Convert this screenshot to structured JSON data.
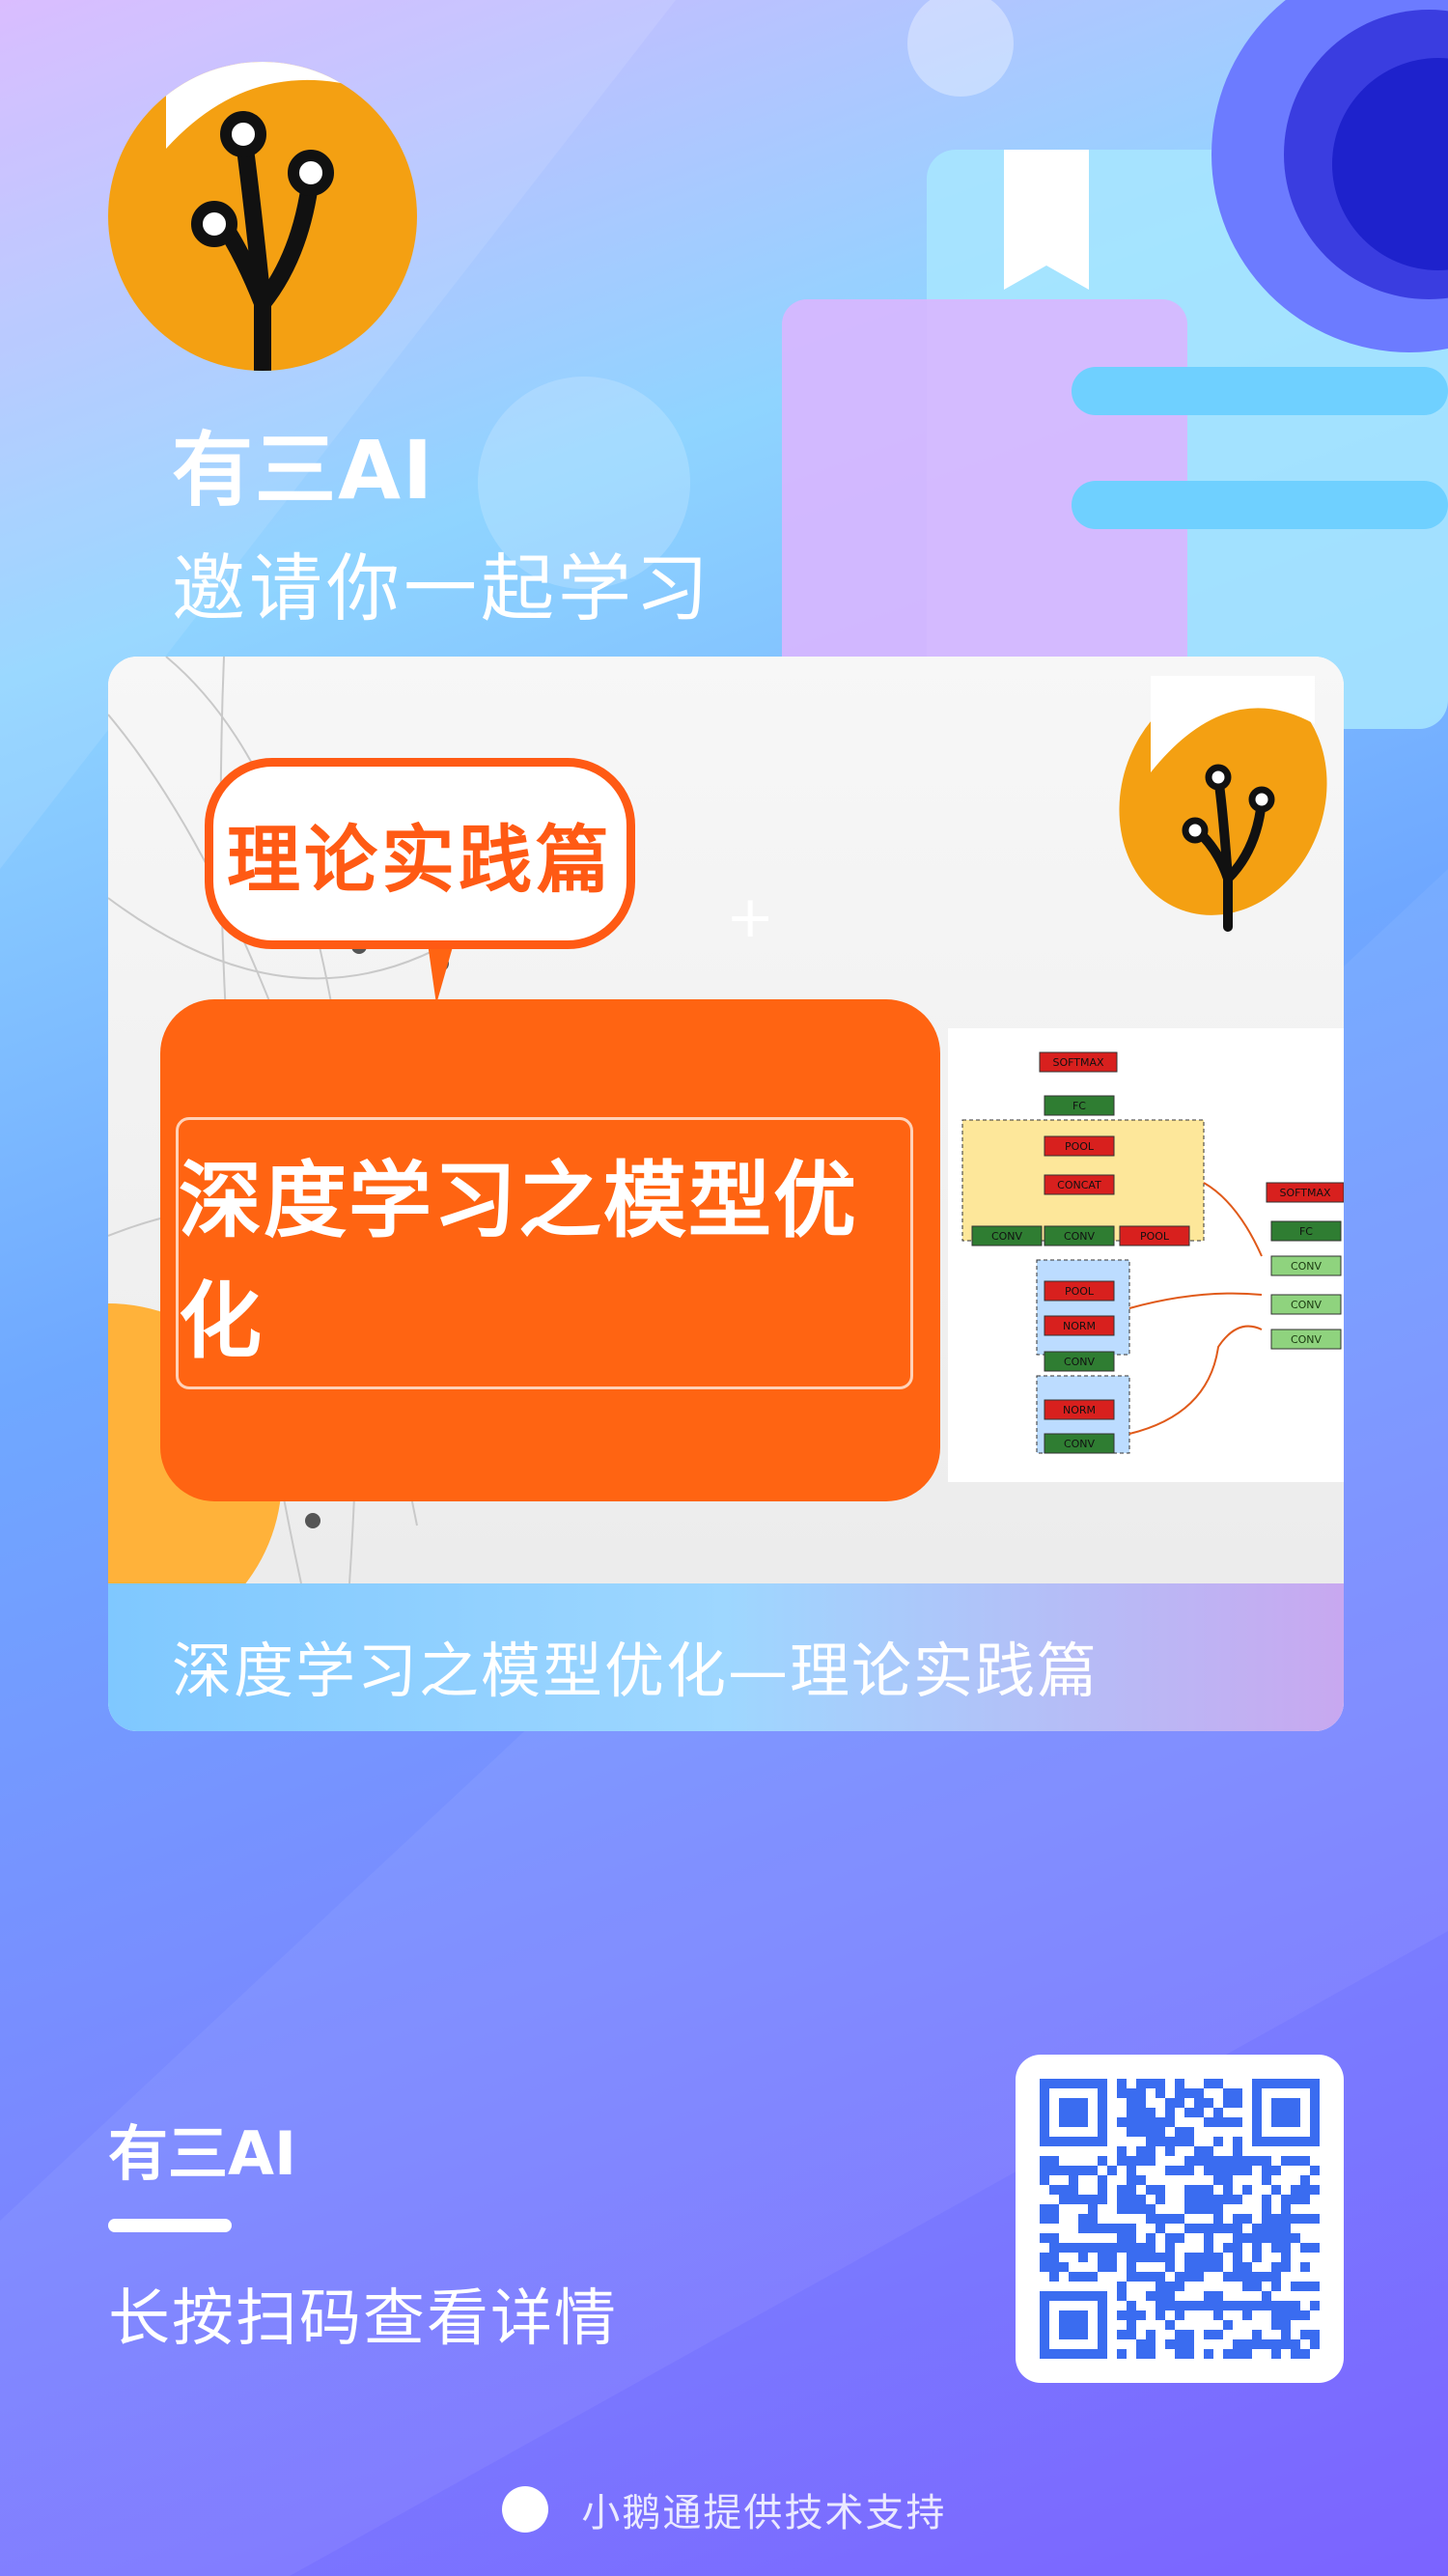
{
  "header": {
    "title": "有三AI",
    "subtitle": "邀请你一起学习"
  },
  "card": {
    "tag": "理论实践篇",
    "headline": "深度学习之模型优化",
    "caption": "深度学习之模型优化—理论实践篇",
    "diagram": {
      "left_column": [
        "SOFTMAX",
        "FC",
        "POOL",
        "CONCAT",
        "CONV",
        "CONV",
        "POOL",
        "POOL",
        "NORM",
        "CONV",
        "NORM",
        "CONV"
      ],
      "right_column": [
        "SOFTMAX",
        "FC",
        "CONV",
        "CONV",
        "CONV"
      ]
    }
  },
  "bottom": {
    "title": "有三AI",
    "instruction": "长按扫码查看详情"
  },
  "footer": {
    "text": "小鹅通提供技术支持"
  },
  "colors": {
    "accent_orange": "#ff6412",
    "logo_orange": "#f4a012",
    "qr_blue": "#3a6cf0"
  }
}
